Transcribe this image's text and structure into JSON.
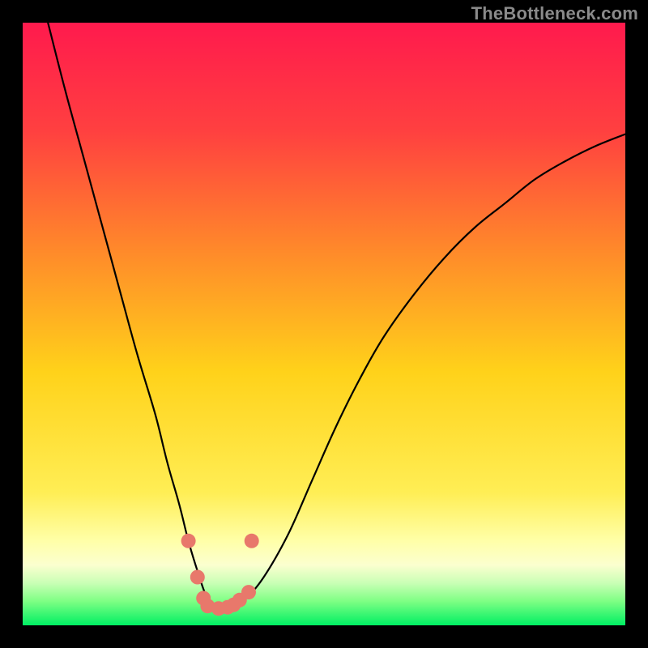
{
  "watermark": "TheBottleneck.com",
  "colors": {
    "top": "#ff1a4d",
    "upper_mid": "#ff7a2e",
    "mid": "#ffd21a",
    "lower_yellow": "#ffef60",
    "pale_yellow": "#ffffb0",
    "green_light": "#7eff84",
    "green": "#00ef63",
    "curve": "#000000",
    "dot": "#e8786b",
    "frame": "#000000"
  },
  "chart_data": {
    "type": "line",
    "title": "",
    "xlabel": "",
    "ylabel": "",
    "xlim": [
      0,
      100
    ],
    "ylim": [
      0,
      100
    ],
    "x": [
      4.2,
      7,
      10,
      13,
      16,
      19,
      22,
      24,
      26,
      27.5,
      29,
      30,
      31,
      32,
      33,
      34.5,
      37,
      40,
      44,
      48,
      52,
      56,
      60,
      65,
      70,
      75,
      80,
      85,
      90,
      95,
      100
    ],
    "values": [
      100,
      89,
      78,
      67,
      56,
      45,
      35,
      27,
      20,
      14,
      9,
      6,
      3.5,
      2.8,
      2.8,
      3.2,
      4.5,
      8,
      15,
      24,
      33,
      41,
      48,
      55,
      61,
      66,
      70,
      74,
      77,
      79.5,
      81.5
    ],
    "annotations": [
      {
        "x": 27.5,
        "y": 14
      },
      {
        "x": 29.0,
        "y": 8
      },
      {
        "x": 30.0,
        "y": 4.5
      },
      {
        "x": 30.7,
        "y": 3.2
      },
      {
        "x": 32.5,
        "y": 2.8
      },
      {
        "x": 34.0,
        "y": 3.0
      },
      {
        "x": 35.0,
        "y": 3.4
      },
      {
        "x": 36.0,
        "y": 4.2
      },
      {
        "x": 37.5,
        "y": 5.5
      },
      {
        "x": 38.0,
        "y": 14
      }
    ]
  }
}
